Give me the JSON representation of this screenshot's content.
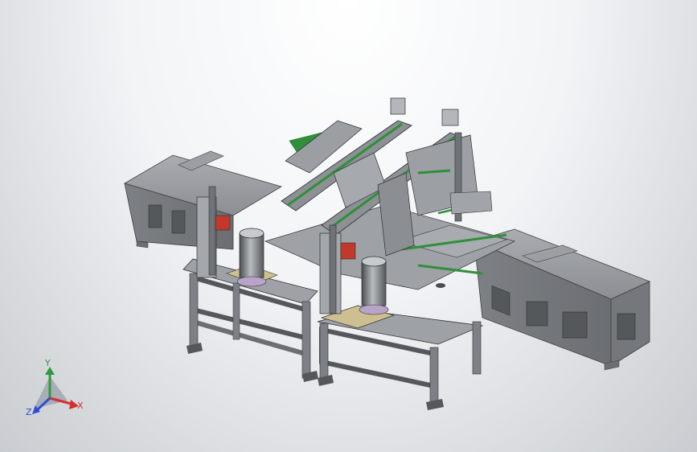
{
  "viewport": {
    "background_top": "#ffffff",
    "background_bottom": "#c9ccd0"
  },
  "model": {
    "frame_color": "#8f9296",
    "frame_dark": "#5c5f63",
    "frame_light": "#b7babd",
    "rail_green": "#2f8f3a",
    "accent_red": "#c0392b",
    "plate_tan": "#cdbf8f",
    "purple_part": "#b9a3c9"
  },
  "triad": {
    "x_label": "X",
    "y_label": "Y",
    "z_label": "Z",
    "x_color": "#d32f2f",
    "y_color": "#2e9a3c",
    "z_color": "#2b4fd1"
  }
}
